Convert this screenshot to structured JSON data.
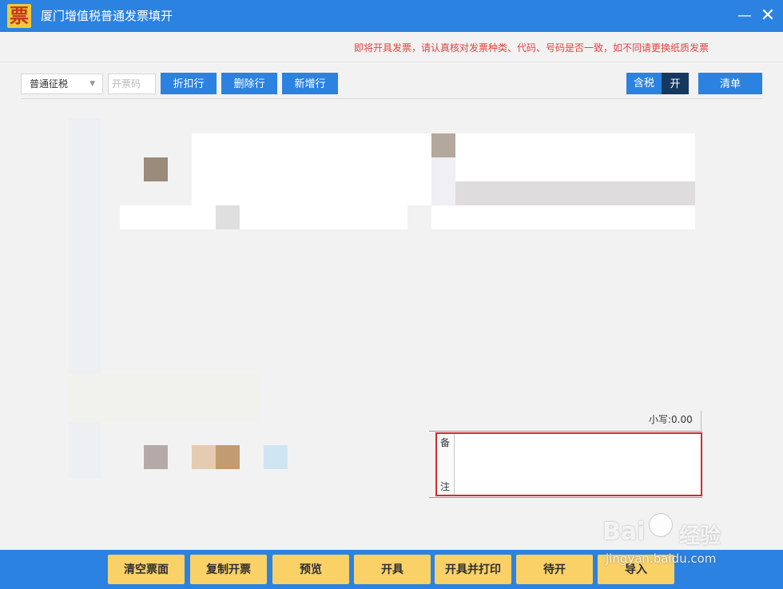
{
  "window": {
    "logo_char": "票",
    "title": "厦门增值税普通发票填开",
    "minimize_glyph": "—",
    "close_glyph": "✕"
  },
  "notice": "即将开具发票，请认真核对发票种类、代码、号码是否一致，如不同请更换纸质发票",
  "toolbar": {
    "tax_type": "普通征税",
    "invoice_code_placeholder": "开票码",
    "discount_label": "折扣行",
    "delete_label": "删除行",
    "add_label": "新增行",
    "tax_included_label": "含税",
    "tax_toggle_label": "开",
    "list_label": "清单"
  },
  "totals": {
    "lowercase_total": "小写:0.00"
  },
  "remarks": {
    "label_top": "备",
    "label_bottom": "注",
    "value": ""
  },
  "actions": {
    "clear": "清空票面",
    "copy": "复制开票",
    "preview": "预览",
    "issue": "开具",
    "issue_print": "开具并打印",
    "pending": "待开",
    "import": "导入"
  },
  "watermark": {
    "brand": "Bai",
    "brand_suffix": "经验",
    "url": "jingyan.baidu.com"
  },
  "colors": {
    "primary": "#2b82e0",
    "dark_toggle": "#17385e",
    "action_yellow": "#f9d167",
    "notice_red": "#e3433f",
    "highlight_red": "#d52b2b"
  }
}
